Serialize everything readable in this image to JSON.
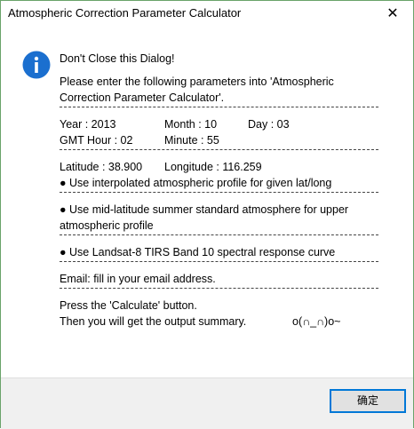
{
  "window": {
    "title": "Atmospheric Correction Parameter Calculator",
    "close_glyph": "✕"
  },
  "icon": {
    "name": "info-icon",
    "glyph": "i",
    "color": "#1b6fcf"
  },
  "message": {
    "heading": "Don't Close this Dialog!",
    "intro_line1": "Please enter the following parameters into 'Atmospheric",
    "intro_line2": "Correction Parameter Calculator'.",
    "year": "Year : 2013",
    "month": "Month : 10",
    "day": "Day : 03",
    "gmt_hour": "GMT Hour : 02",
    "minute": "Minute : 55",
    "latitude": "Latitude : 38.900",
    "longitude": "Longitude : 116.259",
    "profile_option": "● Use interpolated atmospheric profile for given lat/long",
    "atmosphere_line1": "● Use mid-latitude summer standard atmosphere for upper",
    "atmosphere_line2": "atmospheric profile",
    "response_curve": "● Use Landsat-8 TIRS Band 10 spectral response curve",
    "email": "Email: fill in your email address.",
    "press_line": "Press the 'Calculate' button.",
    "then_line": "Then you will get the output summary.",
    "emoticon": "o(∩_∩)o~"
  },
  "buttons": {
    "ok_label": "确定"
  },
  "colors": {
    "window_border": "#6aa36a",
    "footer_bg": "#f0f0f0",
    "button_border": "#0078d7",
    "button_bg": "#e1e1e1"
  }
}
